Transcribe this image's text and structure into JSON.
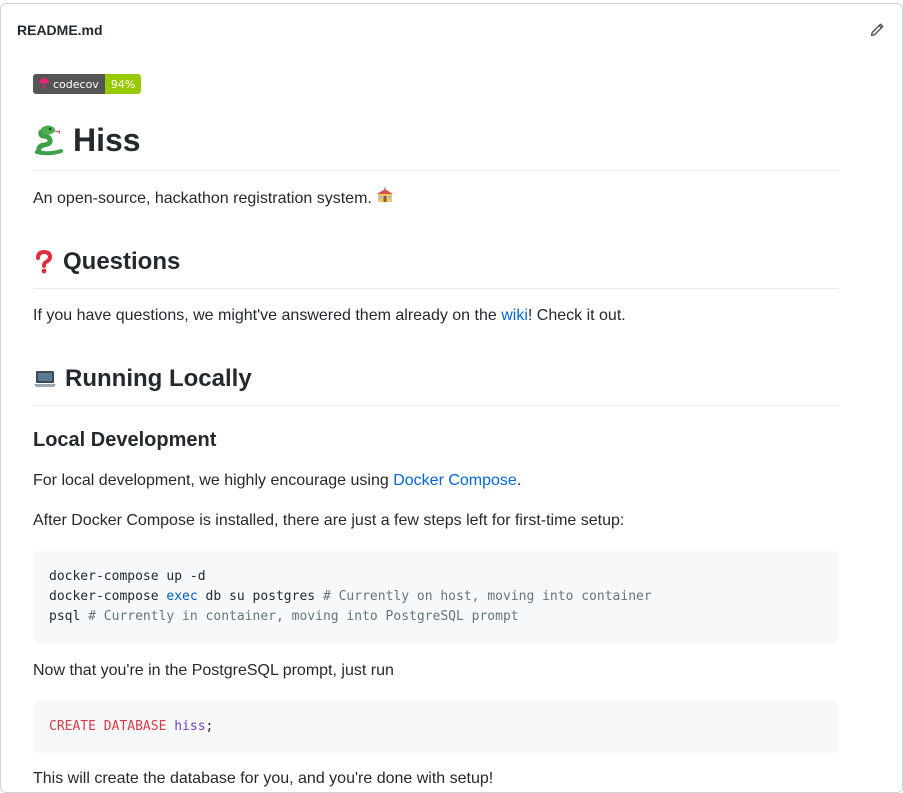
{
  "header": {
    "file_name": "README.md",
    "edit_icon": "pencil-icon"
  },
  "badge": {
    "label": "codecov",
    "value": "94%",
    "label_color": "#555555",
    "value_color": "#97ca00"
  },
  "title": {
    "emoji": "snake",
    "text": "Hiss"
  },
  "intro": {
    "text": "An open-source, hackathon registration system.",
    "emoji": "school-building"
  },
  "questions": {
    "emoji": "red-question-mark",
    "heading": "Questions",
    "text_before": "If you have questions, we might've answered them already on the ",
    "link": "wiki",
    "text_after": "! Check it out."
  },
  "running": {
    "emoji": "laptop",
    "heading": "Running Locally",
    "local_dev": {
      "heading": "Local Development",
      "p1_before": "For local development, we highly encourage using ",
      "p1_link": "Docker Compose",
      "p1_after": ".",
      "p2": "After Docker Compose is installed, there are just a few steps left for first-time setup:",
      "code1": [
        {
          "cmd": "docker-compose up -d",
          "exec": "",
          "rest": "",
          "comment": ""
        },
        {
          "cmd": "docker-compose ",
          "exec": "exec",
          "rest": " db su postgres ",
          "comment": "# Currently on host, moving into container"
        },
        {
          "cmd": "psql ",
          "exec": "",
          "rest": "",
          "comment": "# Currently in container, moving into PostgreSQL prompt"
        }
      ],
      "p3": "Now that you're in the PostgreSQL prompt, just run",
      "code2": {
        "kw": "CREATE DATABASE",
        "ident": "hiss",
        "end": ";"
      },
      "p4": "This will create the database for you, and you're done with setup!"
    }
  },
  "colors": {
    "link": "#0366d6",
    "code_bg": "#f6f8fa",
    "border": "#eaecef",
    "accent": "#d73a49"
  }
}
